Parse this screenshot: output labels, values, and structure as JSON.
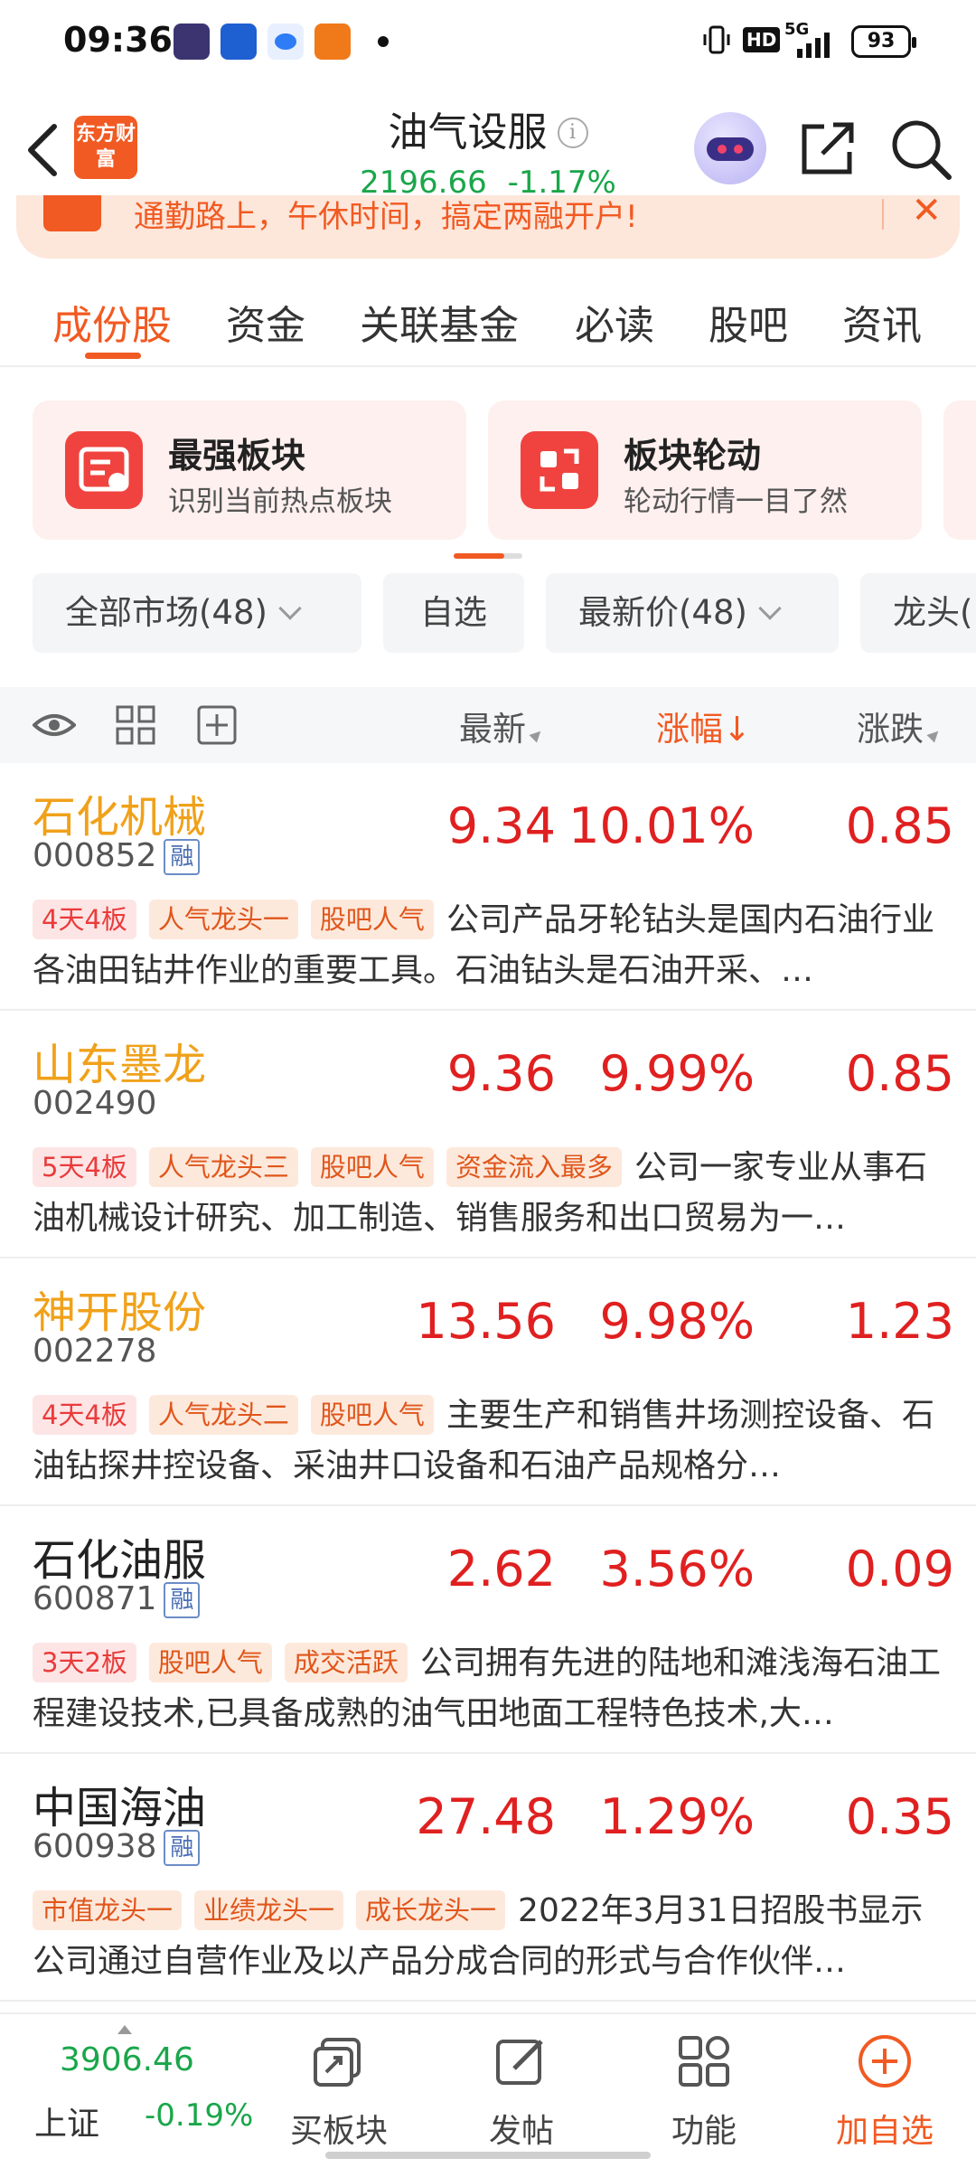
{
  "status_bar": {
    "time": "09:36",
    "network": "5G",
    "hd": "HD",
    "battery": "93"
  },
  "header": {
    "logo_text": "东方财富",
    "title": "油气设服",
    "info": "i",
    "price": "2196.66",
    "change_pct": "-1.17%"
  },
  "banner": {
    "text": "通勤路上，午休时间，搞定两融开户!",
    "close": "✕"
  },
  "tabs": [
    {
      "label": "成份股"
    },
    {
      "label": "资金"
    },
    {
      "label": "关联基金"
    },
    {
      "label": "必读"
    },
    {
      "label": "股吧"
    },
    {
      "label": "资讯"
    }
  ],
  "cards": [
    {
      "title": "最强板块",
      "sub": "识别当前热点板块"
    },
    {
      "title": "板块轮动",
      "sub": "轮动行情一目了然"
    }
  ],
  "filters": [
    {
      "label": "全部市场(48)"
    },
    {
      "label": "自选"
    },
    {
      "label": "最新价(48)"
    },
    {
      "label": "龙头("
    }
  ],
  "table_header": {
    "latest": "最新",
    "change_pct": "涨幅↓",
    "change": "涨跌"
  },
  "rows": [
    {
      "name": "石化机械",
      "code": "000852",
      "rong": "融",
      "price": "9.34",
      "pct": "10.01%",
      "chg": "0.85",
      "tags": [
        {
          "text": "4天4板",
          "style": "red"
        },
        {
          "text": "人气龙头一",
          "style": "orange"
        },
        {
          "text": "股吧人气",
          "style": "orange"
        }
      ],
      "desc": "公司产品牙轮钻头是国内石油行业各油田钻井作业的重要工具。石油钻头是石油开采、…"
    },
    {
      "name": "山东墨龙",
      "code": "002490",
      "rong": "",
      "price": "9.36",
      "pct": "9.99%",
      "chg": "0.85",
      "tags": [
        {
          "text": "5天4板",
          "style": "red"
        },
        {
          "text": "人气龙头三",
          "style": "orange"
        },
        {
          "text": "股吧人气",
          "style": "orange"
        },
        {
          "text": "资金流入最多",
          "style": "orange"
        }
      ],
      "desc": "公司一家专业从事石油机械设计研究、加工制造、销售服务和出口贸易为一…"
    },
    {
      "name": "神开股份",
      "code": "002278",
      "rong": "",
      "price": "13.56",
      "pct": "9.98%",
      "chg": "1.23",
      "tags": [
        {
          "text": "4天4板",
          "style": "red"
        },
        {
          "text": "人气龙头二",
          "style": "orange"
        },
        {
          "text": "股吧人气",
          "style": "orange"
        }
      ],
      "desc": "主要生产和销售井场测控设备、石油钻探井控设备、采油井口设备和石油产品规格分…"
    },
    {
      "name": "石化油服",
      "code": "600871",
      "rong": "融",
      "price": "2.62",
      "pct": "3.56%",
      "chg": "0.09",
      "tags": [
        {
          "text": "3天2板",
          "style": "red"
        },
        {
          "text": "股吧人气",
          "style": "orange"
        },
        {
          "text": "成交活跃",
          "style": "orange"
        }
      ],
      "desc": "公司拥有先进的陆地和滩浅海石油工程建设技术,已具备成熟的油气田地面工程特色技术,大…"
    },
    {
      "name": "中国海油",
      "code": "600938",
      "rong": "融",
      "price": "27.48",
      "pct": "1.29%",
      "chg": "0.35",
      "tags": [
        {
          "text": "市值龙头一",
          "style": "orange"
        },
        {
          "text": "业绩龙头一",
          "style": "orange"
        },
        {
          "text": "成长龙头一",
          "style": "orange"
        }
      ],
      "desc": "2022年3月31日招股书显示公司通过自营作业及以产品分成合同的形式与合作伙伴…"
    }
  ],
  "bottom_nav": {
    "index_value": "3906.46",
    "index_name": "上证",
    "index_change": "-0.19%",
    "items": [
      {
        "label": "买板块"
      },
      {
        "label": "发帖"
      },
      {
        "label": "功能"
      },
      {
        "label": "加自选"
      }
    ]
  },
  "colors": {
    "accent": "#f15a22",
    "up": "#e02020",
    "down": "#1aa64a",
    "leader_name": "#f0a11a"
  }
}
